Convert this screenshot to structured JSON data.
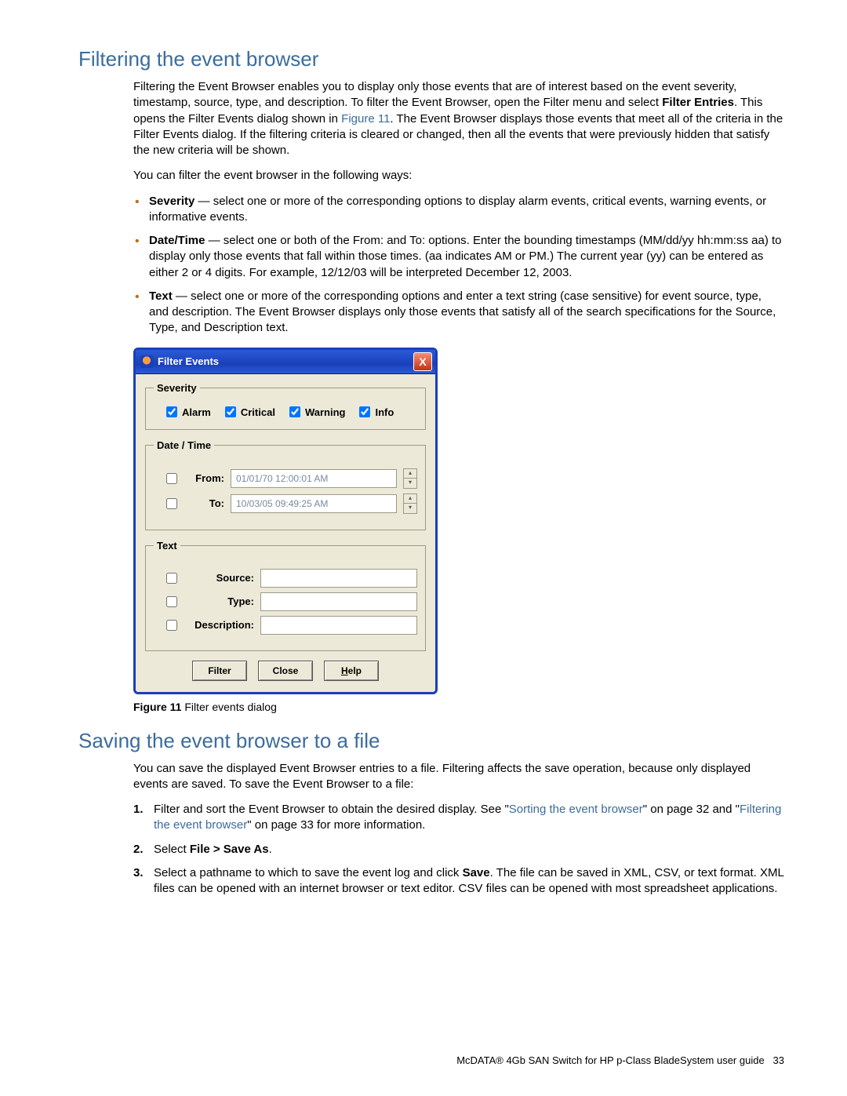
{
  "section1": {
    "title": "Filtering the event browser",
    "para1_a": "Filtering the Event Browser enables you to display only those events that are of interest based on the event severity, timestamp, source, type, and description. To filter the Event Browser, open the Filter menu and select ",
    "filter_entries_bold": "Filter Entries",
    "para1_b": ". This opens the Filter Events dialog shown in ",
    "fig_link": "Figure 11",
    "para1_c": ". The Event Browser displays those events that meet all of the criteria in the Filter Events dialog. If the filtering criteria is cleared or changed, then all the events that were previously hidden that satisfy the new criteria will be shown.",
    "para2": "You can filter the event browser in the following ways:",
    "bullets": [
      {
        "label": "Severity",
        "text": " — select one or more of the corresponding options to display alarm events, critical events, warning events, or informative events."
      },
      {
        "label": "Date/Time",
        "text": " — select one or both of the From: and To: options. Enter the bounding timestamps (MM/dd/yy hh:mm:ss aa) to display only those events that fall within those times. (aa indicates AM or PM.) The current year (yy) can be entered as either 2 or 4 digits. For example, 12/12/03 will be interpreted December 12, 2003."
      },
      {
        "label": "Text",
        "text": " — select one or more of the corresponding options and enter a text string (case sensitive) for event source, type, and description. The Event Browser displays only those events that satisfy all of the search specifications for the Source, Type, and Description text."
      }
    ]
  },
  "dialog": {
    "title": "Filter Events",
    "close_x": "X",
    "severity": {
      "legend": "Severity",
      "alarm": "Alarm",
      "critical": "Critical",
      "warning": "Warning",
      "info": "Info"
    },
    "datetime": {
      "legend": "Date / Time",
      "from_label": "From:",
      "from_value": "01/01/70 12:00:01 AM",
      "to_label": "To:",
      "to_value": "10/03/05 09:49:25 AM"
    },
    "text": {
      "legend": "Text",
      "source": "Source:",
      "type": "Type:",
      "description": "Description:"
    },
    "buttons": {
      "filter": "Filter",
      "close": "Close",
      "help_pre": "H",
      "help_post": "elp"
    }
  },
  "caption": {
    "label": "Figure 11",
    "text": " Filter events dialog"
  },
  "section2": {
    "title": "Saving the event browser to a file",
    "para1": "You can save the displayed Event Browser entries to a file. Filtering affects the save operation, because only displayed events are saved. To save the Event Browser to a file:",
    "steps": [
      {
        "pre": "Filter and sort the Event Browser to obtain the desired display. See \"",
        "link1": "Sorting the event browser",
        "mid": "\" on page 32 and \"",
        "link2": "Filtering the event browser",
        "post": "\" on page 33 for more information."
      },
      {
        "pre": "Select ",
        "bold": "File > Save As",
        "post": "."
      },
      {
        "pre": "Select a pathname to which to save the event log and click ",
        "bold": "Save",
        "post": ". The file can be saved in XML, CSV, or text format. XML files can be opened with an internet browser or text editor. CSV files can be opened with most spreadsheet applications."
      }
    ]
  },
  "footer": {
    "text": "McDATA® 4Gb SAN Switch for HP p-Class BladeSystem user guide",
    "page": "33"
  }
}
